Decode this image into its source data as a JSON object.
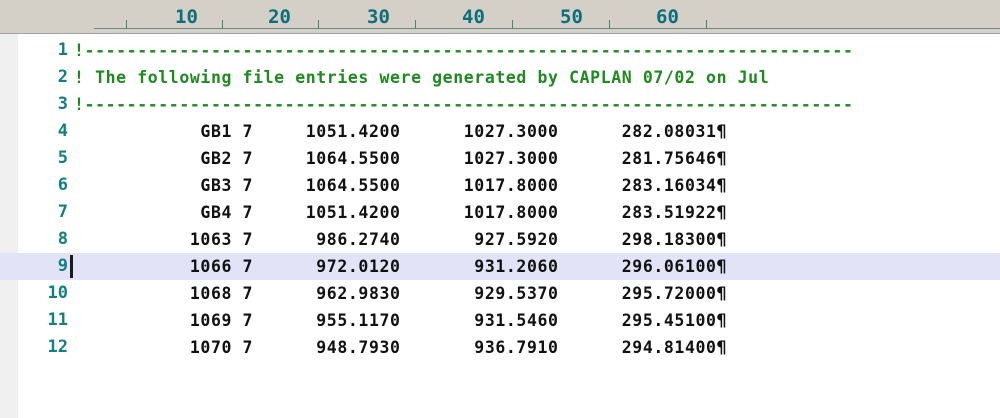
{
  "ruler": {
    "numbers": [
      "10",
      "20",
      "30",
      "40",
      "50",
      "60"
    ]
  },
  "lines": [
    {
      "num": "1",
      "text": "!-------------------------------------------------------------------------",
      "kind": "comment"
    },
    {
      "num": "2",
      "text": "! The following file entries were generated by CAPLAN 07/02 on Jul",
      "kind": "comment"
    },
    {
      "num": "3",
      "text": "!-------------------------------------------------------------------------",
      "kind": "comment"
    },
    {
      "num": "4",
      "text": "            GB1 7     1051.4200      1027.3000      282.08031¶",
      "kind": "data"
    },
    {
      "num": "5",
      "text": "            GB2 7     1064.5500      1027.3000      281.75646¶",
      "kind": "data"
    },
    {
      "num": "6",
      "text": "            GB3 7     1064.5500      1017.8000      283.16034¶",
      "kind": "data"
    },
    {
      "num": "7",
      "text": "            GB4 7     1051.4200      1017.8000      283.51922¶",
      "kind": "data"
    },
    {
      "num": "8",
      "text": "           1063 7      986.2740       927.5920      298.18300¶",
      "kind": "data"
    },
    {
      "num": "9",
      "text": "           1066 7      972.0120       931.2060      296.06100¶",
      "kind": "data",
      "current": true
    },
    {
      "num": "10",
      "text": "           1068 7      962.9830       929.5370      295.72000¶",
      "kind": "data"
    },
    {
      "num": "11",
      "text": "           1069 7      955.1170       931.5460      295.45100¶",
      "kind": "data"
    },
    {
      "num": "12",
      "text": "           1070 7      948.7930       936.7910      294.81400¶",
      "kind": "data"
    }
  ],
  "colors": {
    "comment": "#1f8a1f",
    "data": "#111111",
    "line_number": "#128080",
    "current_line_bg": "#e3e3f7",
    "ruler_bg": "#d4d0c8"
  }
}
